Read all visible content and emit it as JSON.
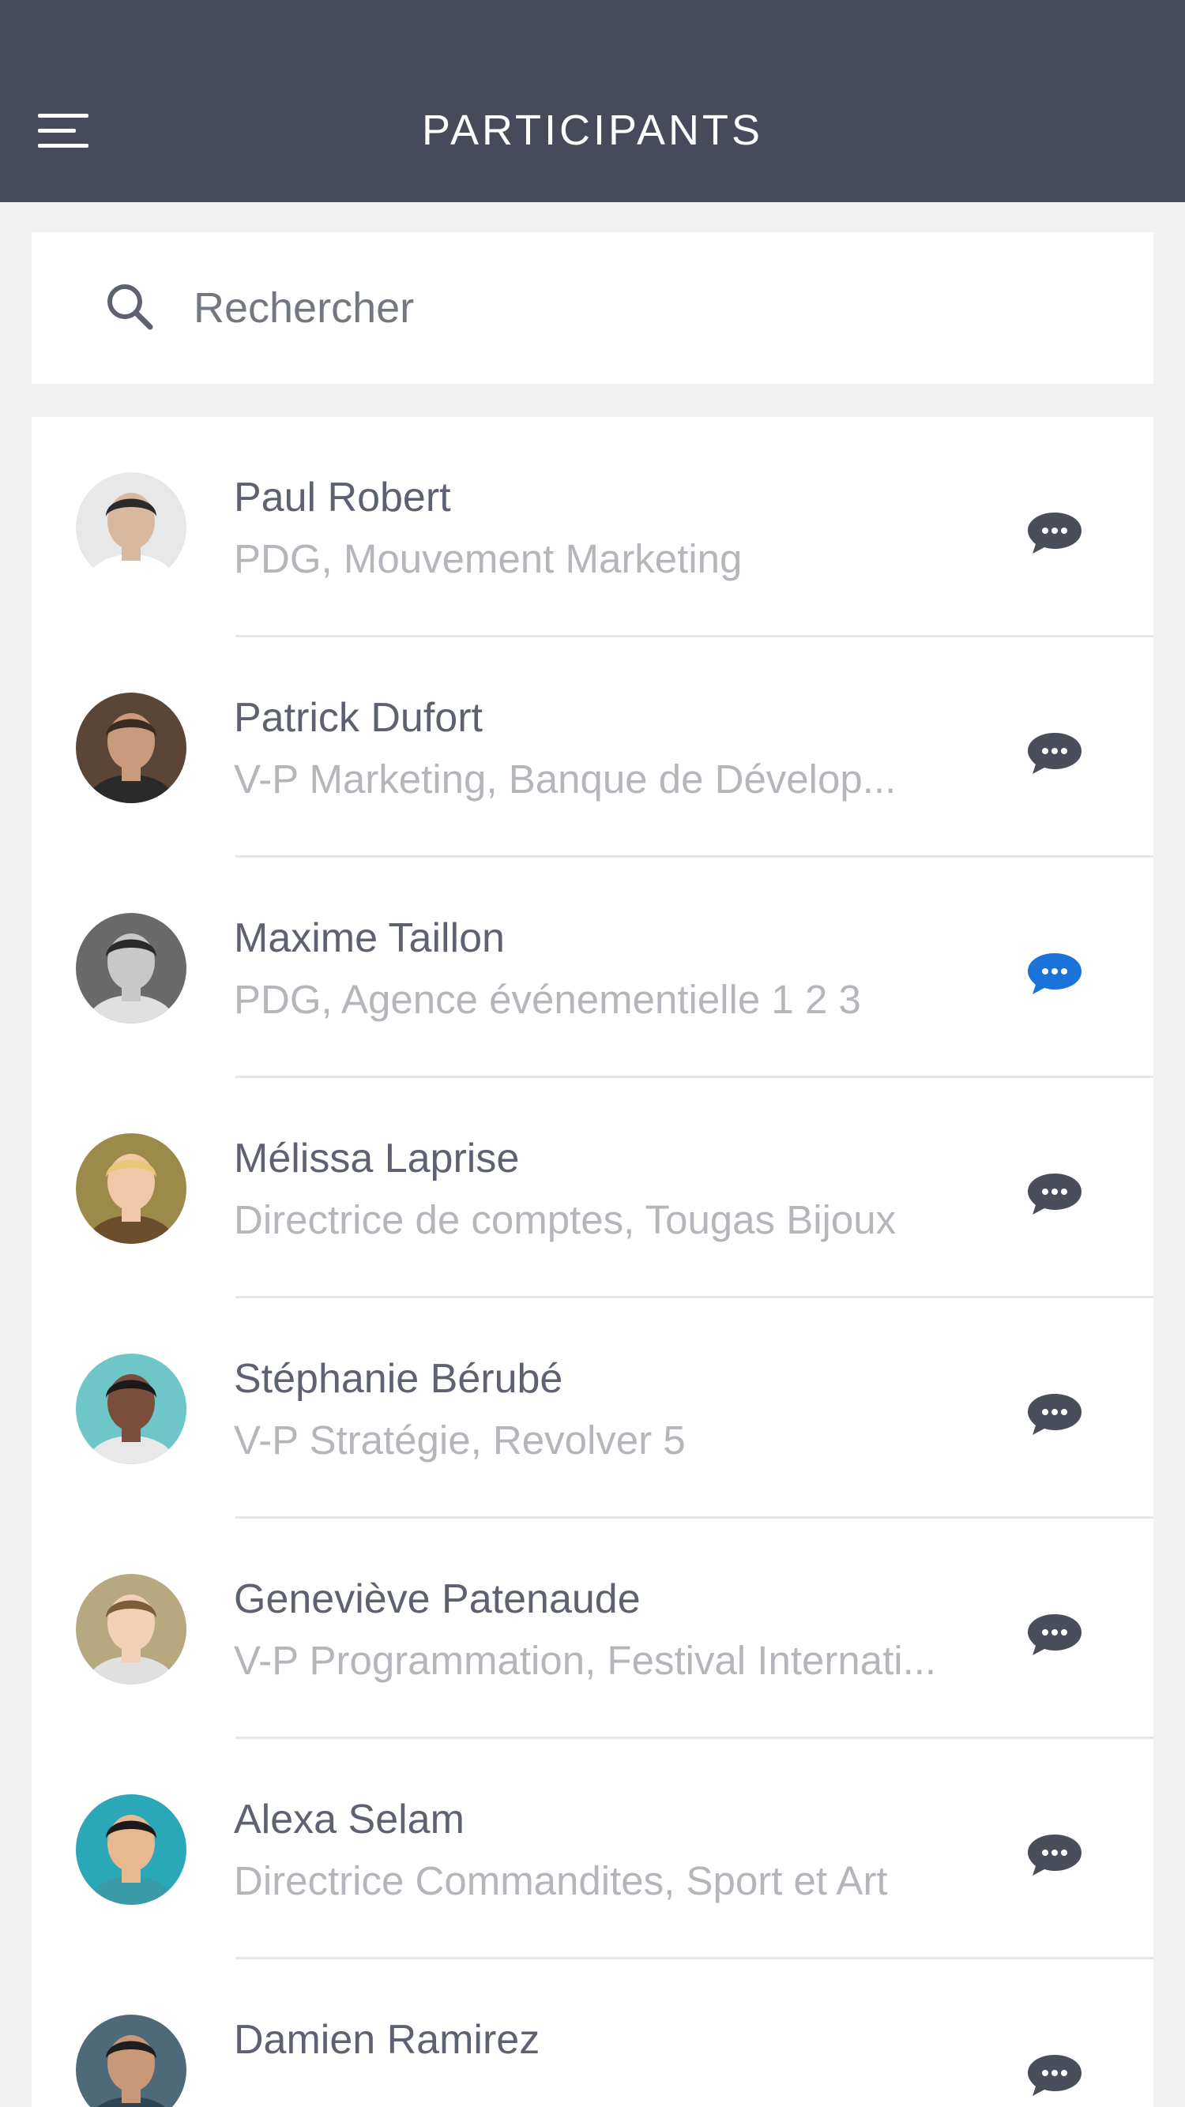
{
  "header": {
    "title": "PARTICIPANTS",
    "menu_icon": "hamburger-menu-icon",
    "background": "#464a5a"
  },
  "search": {
    "placeholder": "Rechercher",
    "value": "",
    "icon": "search-icon"
  },
  "colors": {
    "chat_default": "#4a4d5a",
    "chat_active": "#1a73d9",
    "name_text": "#5d6170",
    "role_text": "#b4b6bc"
  },
  "participants": [
    {
      "name": "Paul Robert",
      "role": "PDG, Mouvement Marketing",
      "chat_active": false
    },
    {
      "name": "Patrick Dufort",
      "role": "V-P Marketing, Banque de Dévelop...",
      "chat_active": false
    },
    {
      "name": "Maxime Taillon",
      "role": "PDG, Agence événementielle 1 2 3",
      "chat_active": true
    },
    {
      "name": "Mélissa Laprise",
      "role": "Directrice de comptes, Tougas Bijoux",
      "chat_active": false
    },
    {
      "name": "Stéphanie Bérubé",
      "role": "V-P Stratégie, Revolver 5",
      "chat_active": false
    },
    {
      "name": "Geneviève Patenaude",
      "role": "V-P Programmation, Festival Internati...",
      "chat_active": false
    },
    {
      "name": "Alexa Selam",
      "role": "Directrice Commandites, Sport et Art",
      "chat_active": false
    },
    {
      "name": "Damien Ramirez",
      "role": "",
      "chat_active": false
    }
  ]
}
